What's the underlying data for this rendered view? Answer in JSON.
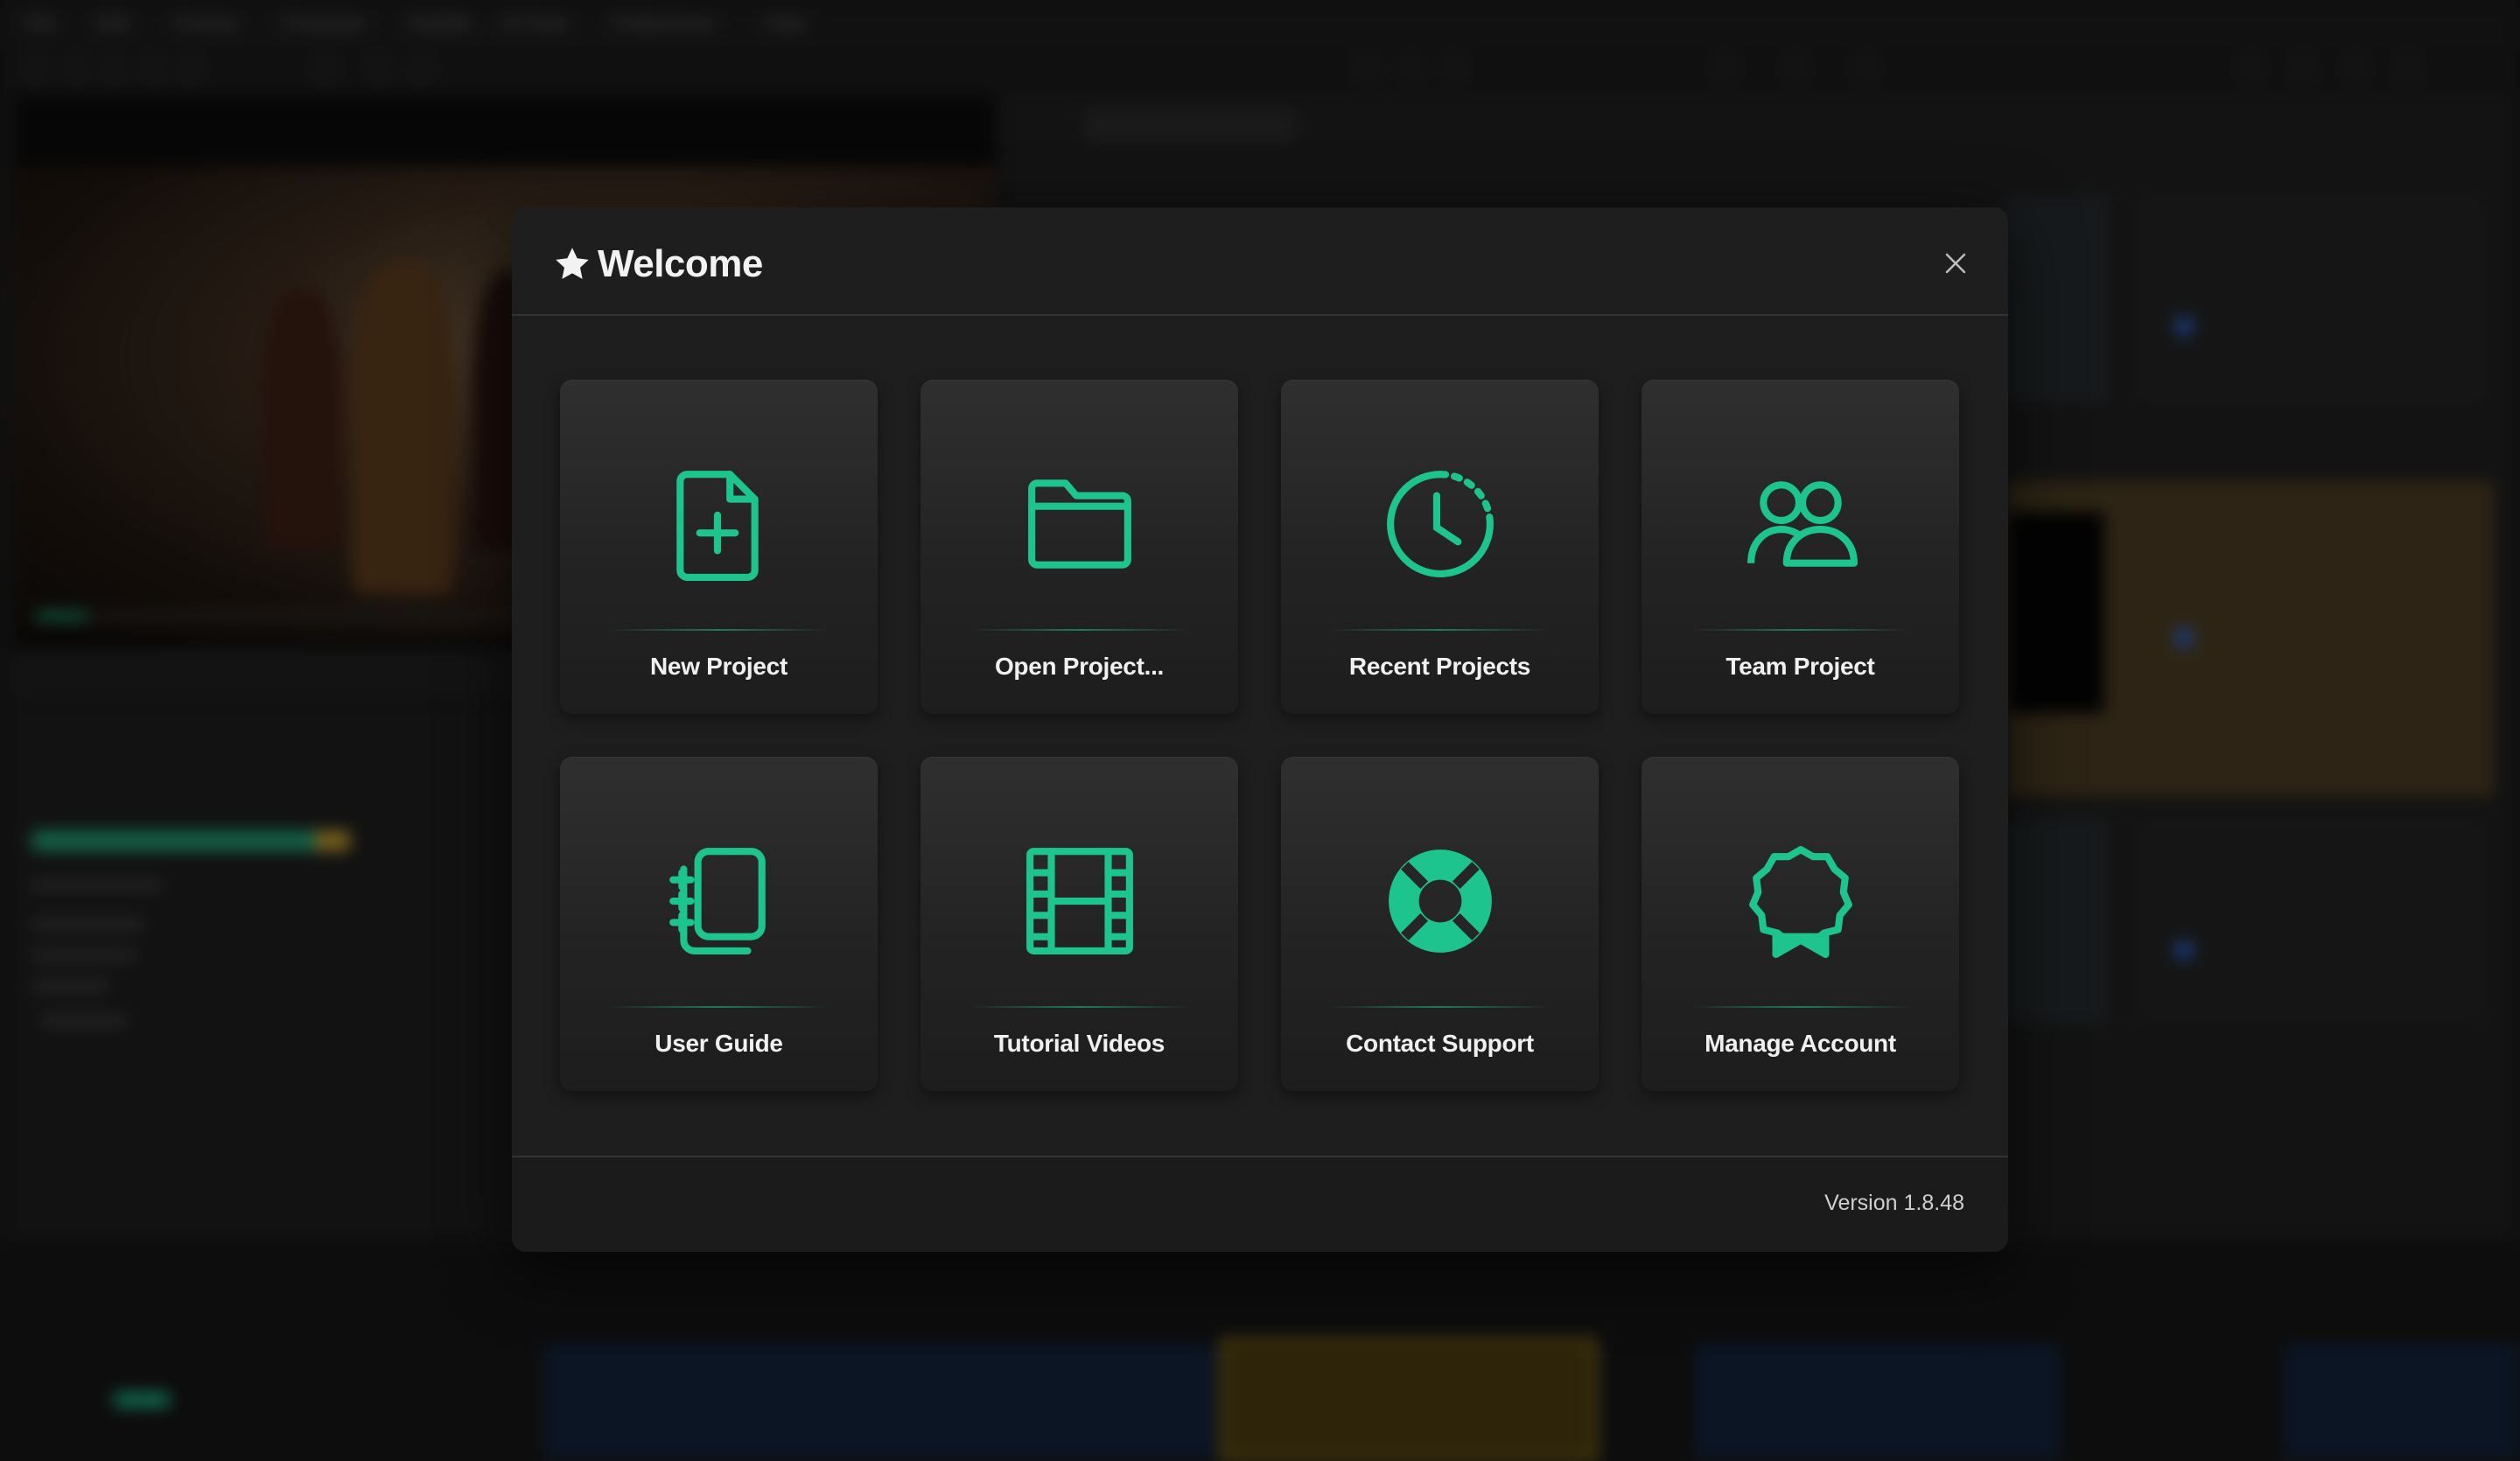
{
  "background_app": {
    "menu": [
      "File",
      "Edit",
      "Format",
      "Character",
      "Subtitle",
      "AI Tools",
      "Preferences",
      "Help"
    ]
  },
  "modal": {
    "title": "Welcome",
    "title_icon": "star-icon",
    "close_icon": "close-icon",
    "accent_color": "#1dc48d",
    "cards": [
      {
        "label": "New Project",
        "icon": "file-plus-icon"
      },
      {
        "label": "Open Project...",
        "icon": "folder-icon"
      },
      {
        "label": "Recent Projects",
        "icon": "clock-history-icon"
      },
      {
        "label": "Team Project",
        "icon": "people-icon"
      },
      {
        "label": "User Guide",
        "icon": "document-stack-icon"
      },
      {
        "label": "Tutorial Videos",
        "icon": "film-icon"
      },
      {
        "label": "Contact Support",
        "icon": "lifebuoy-icon"
      },
      {
        "label": "Manage Account",
        "icon": "award-badge-icon"
      }
    ],
    "version": "Version 1.8.48"
  }
}
